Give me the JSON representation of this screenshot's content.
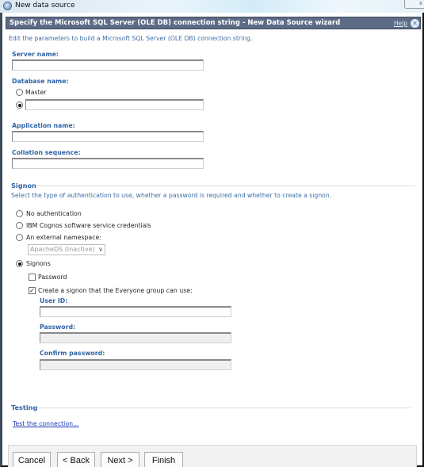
{
  "window": {
    "title": "New data source",
    "app_icon": "cognos-globe-icon",
    "close_label": "x"
  },
  "wizard": {
    "header_title": "Specify the Microsoft SQL Server (OLE DB) connection string - New Data Source wizard",
    "help_label": "Help",
    "close_icon": "close-circle-icon",
    "intro": "Edit the parameters to build a Microsoft SQL Server (OLE DB) connection string."
  },
  "connection": {
    "server_name": {
      "label": "Server name:",
      "value": ""
    },
    "database_name": {
      "label": "Database name:",
      "options": [
        {
          "label": "Master",
          "selected": false
        },
        {
          "label": "",
          "selected": true,
          "value": ""
        }
      ]
    },
    "application_name": {
      "label": "Application name:",
      "value": ""
    },
    "collation_sequence": {
      "label": "Collation sequence:",
      "value": ""
    }
  },
  "signon": {
    "title": "Signon",
    "description": "Select the type of authentication to use, whether a password is required and whether to create a signon.",
    "options": [
      {
        "label": "No authentication",
        "selected": false
      },
      {
        "label": "IBM Cognos software service credentials",
        "selected": false
      },
      {
        "label": "An external namespace:",
        "selected": false
      },
      {
        "label": "Signons",
        "selected": true
      }
    ],
    "namespace_select": {
      "value": "ApacheDS (Inactive)",
      "disabled": true
    },
    "password_checkbox": {
      "label": "Password",
      "checked": false
    },
    "create_signon_checkbox": {
      "label": "Create a signon that the Everyone group can use:",
      "checked": true
    },
    "user_id": {
      "label": "User ID:",
      "value": ""
    },
    "password": {
      "label": "Password:",
      "value": "",
      "disabled": true
    },
    "confirm_password": {
      "label": "Confirm password:",
      "value": "",
      "disabled": true
    }
  },
  "testing": {
    "title": "Testing",
    "link": "Test the connection..."
  },
  "footer": {
    "cancel": "Cancel",
    "back": "< Back",
    "next": "Next >",
    "finish": "Finish"
  },
  "colors": {
    "header_bg": "#5d6b85",
    "label_blue": "#2f64a6",
    "link_blue": "#1a37b6"
  }
}
